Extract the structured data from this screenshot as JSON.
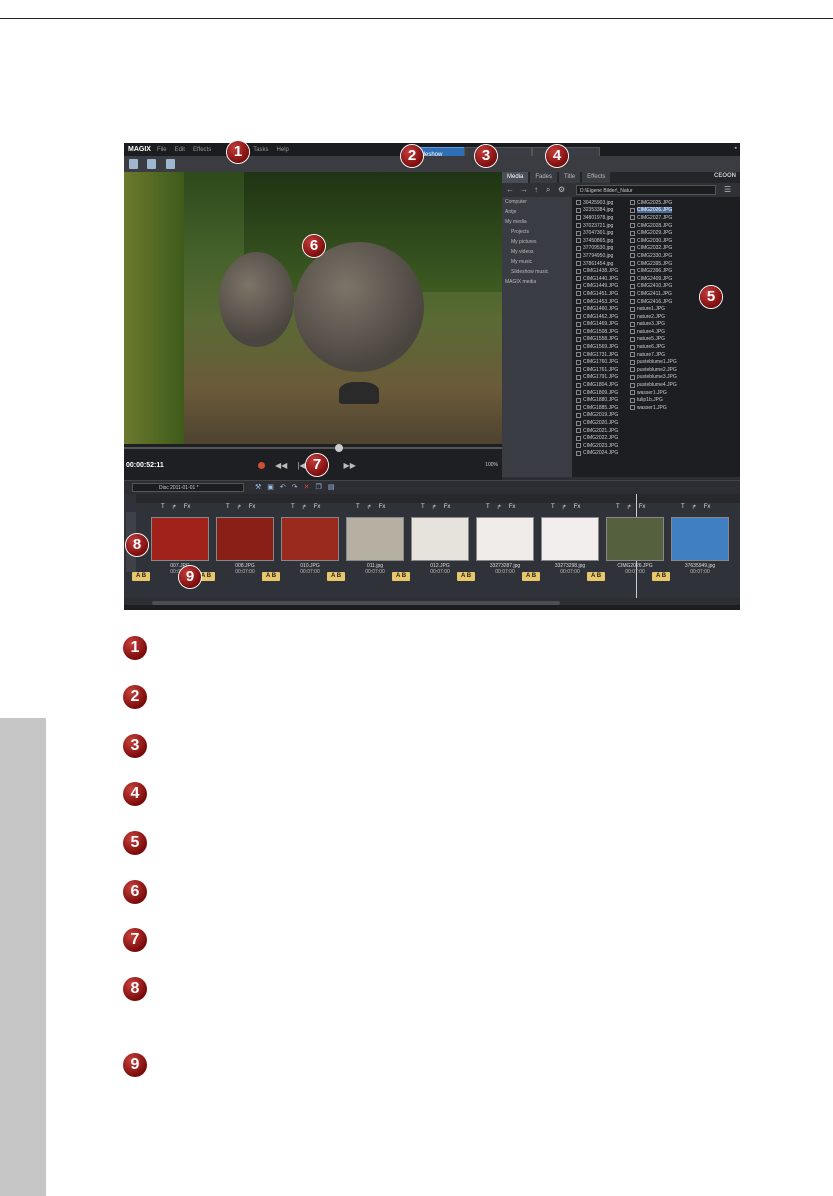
{
  "app": {
    "brand": "MAGIX",
    "menu": [
      "File",
      "Edit",
      "Effects",
      "Tasks",
      "Help"
    ],
    "modes": [
      "Slideshow",
      "",
      ""
    ],
    "media_tabs": [
      "Media",
      "Fades",
      "Title",
      "Effects"
    ],
    "logo": "CEOON",
    "path": "D:\\Eigene Bilder\\_Natur",
    "tree": [
      "Computer",
      "Antje",
      "My media",
      "Projects",
      "My pictures",
      "My videos",
      "My music",
      "Slideshow music",
      "MAGIX media"
    ],
    "files_col1": [
      "30425903.jpg",
      "32353384.jpg",
      "34801978.jpg",
      "37023721.jpg",
      "37047301.jpg",
      "37450865.jpg",
      "37709530.jpg",
      "37794950.jpg",
      "37861454.jpg",
      "CIMG1438.JPG",
      "CIMG1440.JPG",
      "CIMG1449.JPG",
      "CIMG1451.JPG",
      "CIMG1453.JPG",
      "CIMG1460.JPG",
      "CIMG1462.JPG",
      "CIMG1469.JPG",
      "CIMG1508.JPG",
      "CIMG1558.JPG",
      "CIMG1569.JPG",
      "CIMG1731.JPG",
      "CIMG1760.JPG",
      "CIMG1761.JPG",
      "CIMG1791.JPG",
      "CIMG1804.JPG",
      "CIMG1809.JPG",
      "CIMG1880.JPG",
      "CIMG1885.JPG",
      "CIMG2019.JPG",
      "CIMG2020.JPG",
      "CIMG2021.JPG",
      "CIMG2022.JPG",
      "CIMG2023.JPG",
      "CIMG2024.JPG"
    ],
    "files_col2": [
      "CIMG2025.JPG",
      "CIMG2026.JPG",
      "CIMG2027.JPG",
      "CIMG2028.JPG",
      "CIMG2029.JPG",
      "CIMG2030.JPG",
      "CIMG2032.JPG",
      "CIMG2330.JPG",
      "CIMG2395.JPG",
      "CIMG2396.JPG",
      "CIMG2409.JPG",
      "CIMG2410.JPG",
      "CIMG2411.JPG",
      "CIMG2416.JPG",
      "nature1.JPG",
      "nature2.JPG",
      "nature3.JPG",
      "nature4.JPG",
      "nature5.JPG",
      "nature6.JPG",
      "nature7.JPG",
      "pusteblume1.JPG",
      "pusteblume2.JPG",
      "pusteblume3.JPG",
      "pusteblume4.JPG",
      "wasser1.JPG",
      "tulip1b.JPG",
      "wasser1.JPG"
    ],
    "timecode": "00:00:52:11",
    "zoom": "100%",
    "project": "Disc 2011-01-01 *",
    "clips": [
      {
        "name": "007.JPG",
        "dur": "00:07:00",
        "color": "#a1221a"
      },
      {
        "name": "008.JPG",
        "dur": "00:07:00",
        "color": "#8a1f18"
      },
      {
        "name": "010.JPG",
        "dur": "00:07:00",
        "color": "#9a2a1e"
      },
      {
        "name": "011.jpg",
        "dur": "00:07:00",
        "color": "#b5b0a2"
      },
      {
        "name": "012.JPG",
        "dur": "00:07:00",
        "color": "#e6e2dc"
      },
      {
        "name": "33273287.jpg",
        "dur": "00:07:00",
        "color": "#f0ecea"
      },
      {
        "name": "33273298.jpg",
        "dur": "00:07:00",
        "color": "#f2eeee"
      },
      {
        "name": "CIMG2026.JPG",
        "dur": "00:07:00",
        "color": "#55603e"
      },
      {
        "name": "37635949.jpg",
        "dur": "00:07:00",
        "color": "#3f7fc2"
      }
    ],
    "ab_label": "A B",
    "fx_label": "Fx"
  },
  "callouts": [
    "1",
    "2",
    "3",
    "4",
    "5",
    "6",
    "7",
    "8",
    "9"
  ],
  "legend": [
    "1",
    "2",
    "3",
    "4",
    "5",
    "6",
    "7",
    "8",
    "9"
  ]
}
